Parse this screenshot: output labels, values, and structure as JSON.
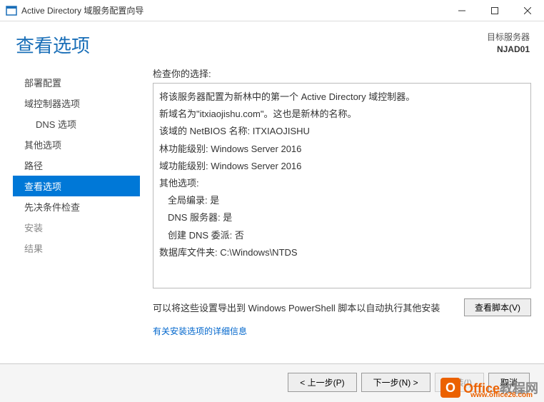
{
  "window": {
    "title": "Active Directory 域服务配置向导"
  },
  "header": {
    "heading": "查看选项",
    "target_label": "目标服务器",
    "target_server": "NJAD01"
  },
  "sidebar": {
    "items": [
      {
        "label": "部署配置",
        "enabled": true,
        "selected": false,
        "indent": false
      },
      {
        "label": "域控制器选项",
        "enabled": true,
        "selected": false,
        "indent": false
      },
      {
        "label": "DNS 选项",
        "enabled": true,
        "selected": false,
        "indent": true
      },
      {
        "label": "其他选项",
        "enabled": true,
        "selected": false,
        "indent": false
      },
      {
        "label": "路径",
        "enabled": true,
        "selected": false,
        "indent": false
      },
      {
        "label": "查看选项",
        "enabled": true,
        "selected": true,
        "indent": false
      },
      {
        "label": "先决条件检查",
        "enabled": true,
        "selected": false,
        "indent": false
      },
      {
        "label": "安装",
        "enabled": false,
        "selected": false,
        "indent": false
      },
      {
        "label": "结果",
        "enabled": false,
        "selected": false,
        "indent": false
      }
    ]
  },
  "main": {
    "check_label": "检查你的选择:",
    "review_lines": [
      {
        "text": "将该服务器配置为新林中的第一个 Active Directory 域控制器。",
        "indent": false
      },
      {
        "text": "新域名为\"itxiaojishu.com\"。这也是新林的名称。",
        "indent": false
      },
      {
        "text": "该域的 NetBIOS 名称: ITXIAOJISHU",
        "indent": false
      },
      {
        "text": "林功能级别: Windows Server 2016",
        "indent": false
      },
      {
        "text": "域功能级别: Windows Server 2016",
        "indent": false
      },
      {
        "text": "其他选项:",
        "indent": false
      },
      {
        "text": "全局编录: 是",
        "indent": true
      },
      {
        "text": "DNS 服务器: 是",
        "indent": true
      },
      {
        "text": "创建 DNS 委派: 否",
        "indent": true
      },
      {
        "text": "数据库文件夹: C:\\Windows\\NTDS",
        "indent": false
      }
    ],
    "export_text": "可以将这些设置导出到 Windows PowerShell 脚本以自动执行其他安装",
    "script_button": "查看脚本(V)",
    "more_link": "有关安装选项的详细信息"
  },
  "footer": {
    "prev": "< 上一步(P)",
    "next": "下一步(N) >",
    "install": "安装(I)",
    "cancel": "取消"
  },
  "watermark": {
    "main": "Office",
    "suffix": "教程网",
    "url": "www.office26.com"
  }
}
